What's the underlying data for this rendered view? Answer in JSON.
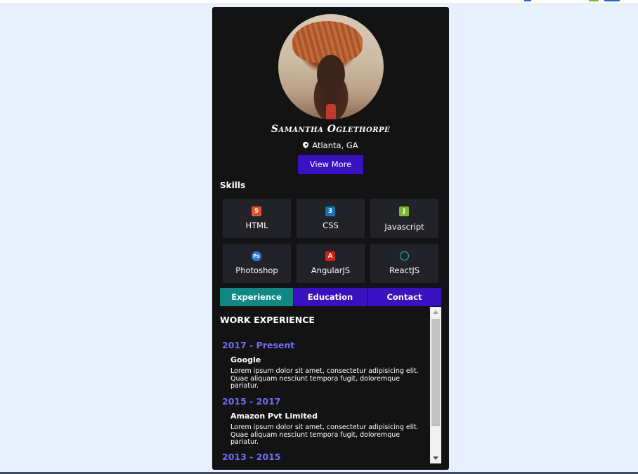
{
  "profile": {
    "name": "Samantha Oglethorpe",
    "location": "Atlanta, GA",
    "view_more": "View More"
  },
  "skills": {
    "title": "Skills",
    "items": [
      {
        "label": "HTML",
        "icon": "html5-icon",
        "color": "#e34f26"
      },
      {
        "label": "CSS",
        "icon": "css3-icon",
        "color": "#1572b6"
      },
      {
        "label": "Javascript",
        "icon": "javascript-icon",
        "color": "#7bb928"
      },
      {
        "label": "Photoshop",
        "icon": "photoshop-icon",
        "color": "#2e7cd6"
      },
      {
        "label": "AngularJS",
        "icon": "angular-icon",
        "color": "#dd1b16"
      },
      {
        "label": "ReactJS",
        "icon": "react-icon",
        "color": "#2fb8e0"
      }
    ]
  },
  "tabs": [
    {
      "label": "Experience",
      "color": "#0d8a84",
      "active": true
    },
    {
      "label": "Education",
      "color": "#3a10c4"
    },
    {
      "label": "Contact",
      "color": "#3a10c4"
    }
  ],
  "experience": {
    "title": "WORK EXPERIENCE",
    "items": [
      {
        "years": "2017 - Present",
        "company": "Google",
        "description": "Lorem ipsum dolor sit amet, consectetur adipisicing elit. Quae aliquam nesciunt tempora fugit, doloremque pariatur."
      },
      {
        "years": "2015 - 2017",
        "company": "Amazon Pvt Limited",
        "description": "Lorem ipsum dolor sit amet, consectetur adipisicing elit. Quae aliquam nesciunt tempora fugit, doloremque pariatur."
      },
      {
        "years": "2013 - 2015"
      }
    ]
  },
  "colors": {
    "accent": "#3a10c4",
    "teal": "#0d8a84",
    "year": "#6f6cff",
    "card": "#131314",
    "page": "#e8f0fd"
  }
}
